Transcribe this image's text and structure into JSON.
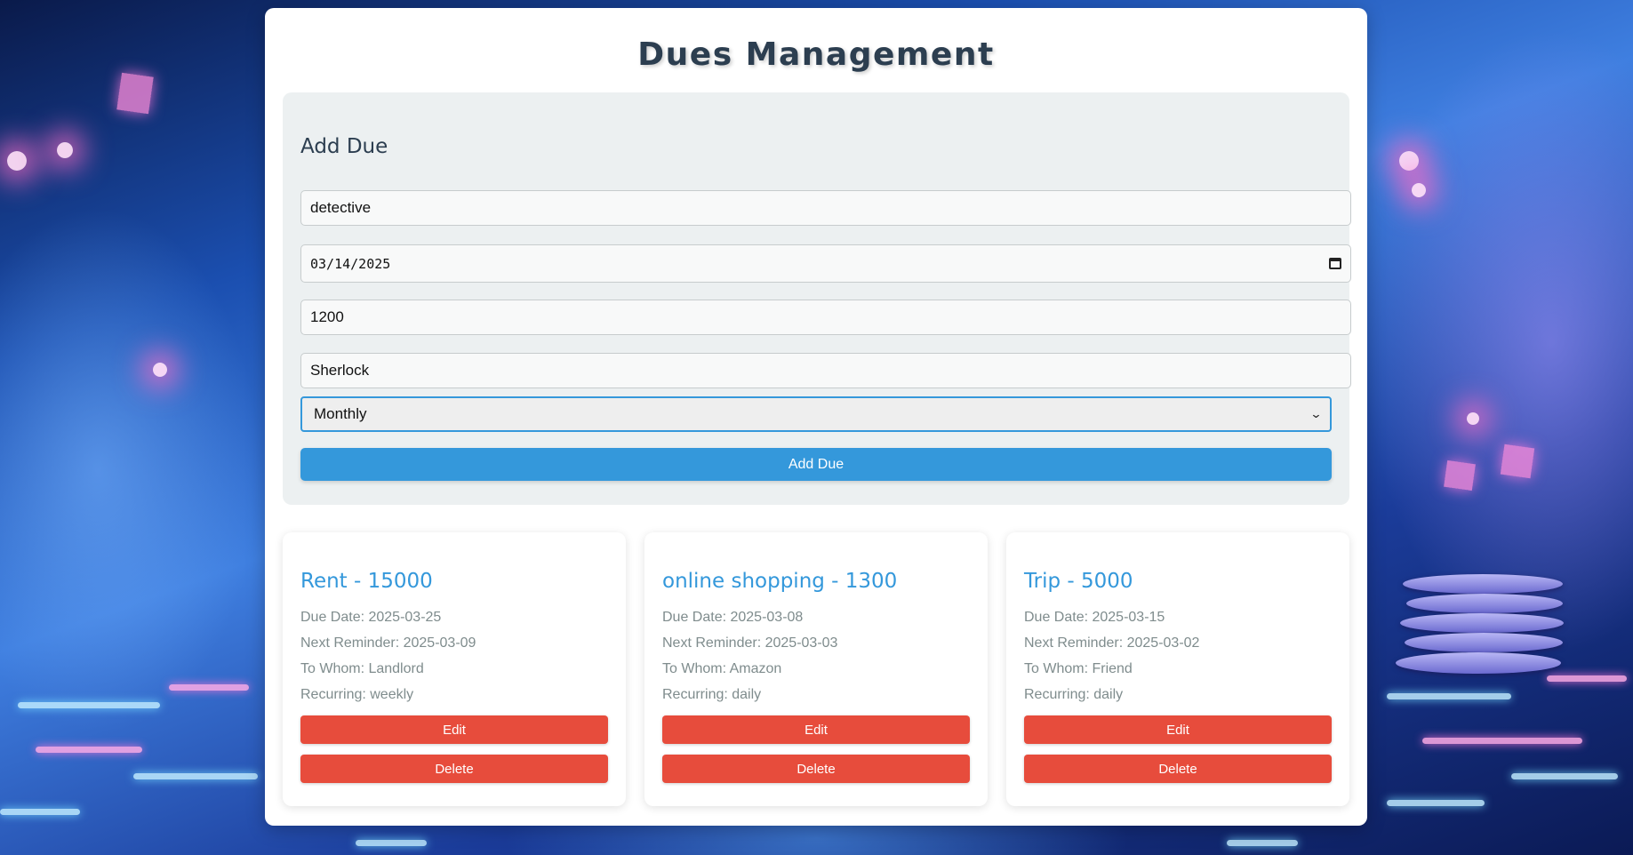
{
  "page": {
    "title": "Dues Management"
  },
  "form": {
    "heading": "Add Due",
    "name_value": "detective",
    "date_value": "03/14/2025",
    "amount_value": "1200",
    "to_whom_value": "Sherlock",
    "recurring_selected": "Monthly",
    "submit_label": "Add Due"
  },
  "dues": [
    {
      "title": "Rent - 15000",
      "due_date": "Due Date: 2025-03-25",
      "next_reminder": "Next Reminder: 2025-03-09",
      "to_whom": "To Whom: Landlord",
      "recurring": "Recurring: weekly",
      "edit_label": "Edit",
      "delete_label": "Delete"
    },
    {
      "title": "online shopping - 1300",
      "due_date": "Due Date: 2025-03-08",
      "next_reminder": "Next Reminder: 2025-03-03",
      "to_whom": "To Whom: Amazon",
      "recurring": "Recurring: daily",
      "edit_label": "Edit",
      "delete_label": "Delete"
    },
    {
      "title": "Trip - 5000",
      "due_date": "Due Date: 2025-03-15",
      "next_reminder": "Next Reminder: 2025-03-02",
      "to_whom": "To Whom: Friend",
      "recurring": "Recurring: daily",
      "edit_label": "Edit",
      "delete_label": "Delete"
    }
  ],
  "colors": {
    "accent": "#3498db",
    "danger": "#e74c3c",
    "heading": "#2c3e50",
    "muted": "#7f8c8d"
  },
  "icons": {
    "date_picker": "calendar-icon",
    "select": "chevron-down-icon"
  }
}
